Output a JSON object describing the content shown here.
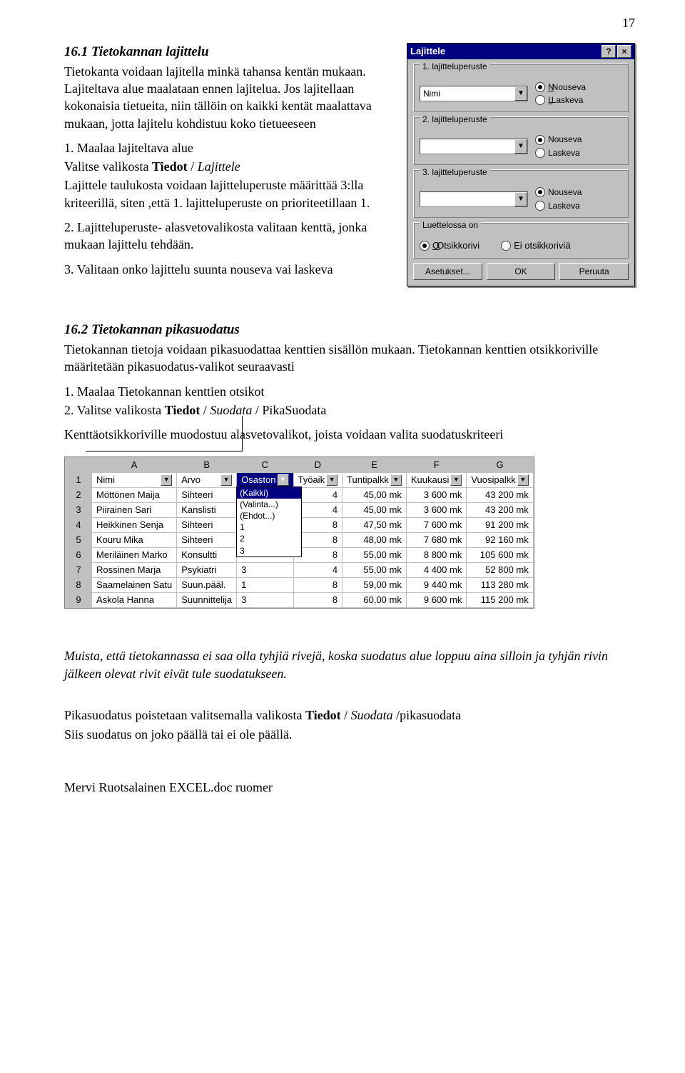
{
  "page_number": "17",
  "section_db_sort_title": "16.1 Tietokannan lajittelu",
  "db_sort_p1": "Tietokanta voidaan lajitella minkä tahansa kentän mukaan. Lajiteltava alue maalataan ennen lajitelua. Jos lajitellaan kokonaisia tietueita, niin tällöin on kaikki kentät maalattava mukaan, jotta lajitelu kohdistuu koko tietueeseen",
  "db_sort_step1_a": "1. Maalaa lajiteltava alue",
  "db_sort_step1_b_prefix": "Valitse valikosta ",
  "db_sort_step1_b_strong": "Tiedot",
  "db_sort_step1_b_mid": " / ",
  "db_sort_step1_b_em": "Lajittele",
  "db_sort_step1_c": "Lajittele taulukosta voidaan lajitteluperuste määrittää 3:lla kriteerillä, siten ,että 1. lajitteluperuste on prioriteetillaan 1.",
  "db_sort_step2": "2. Lajitteluperuste- alasvetovalikosta valitaan kenttä, jonka mukaan lajittelu tehdään.",
  "db_sort_step3": "3. Valitaan onko lajittelu suunta nouseva vai laskeva",
  "dlg": {
    "title": "Lajittele",
    "help_btn": "?",
    "close_btn": "×",
    "g1": "1. lajitteluperuste",
    "g2": "2. lajitteluperuste",
    "g3": "3. lajitteluperuste",
    "combo1": "Nimi",
    "combo2": "",
    "combo3": "",
    "nouseva": "Nouseva",
    "laskeva": "Laskeva",
    "list_legend": "Luettelossa on",
    "opt_header": "Otsikkorivi",
    "opt_noheader": "Ei otsikkoriviä",
    "btn_settings": "Asetukset...",
    "btn_ok": "OK",
    "btn_cancel": "Peruuta"
  },
  "section_quick_title": "16.2 Tietokannan pikasuodatus",
  "quick_p1": "Tietokannan tietoja voidaan pikasuodattaa kenttien sisällön mukaan. Tietokannan kenttien otsikkoriville määritetään pikasuodatus-valikot seuraavasti",
  "quick_step1": "1. Maalaa Tietokannan kenttien otsikot",
  "quick_step2_prefix": "2. Valitse valikosta ",
  "quick_step2_strong": "Tiedot",
  "quick_step2_mid1": " / ",
  "quick_step2_em1": "Suodata",
  "quick_step2_mid2": " / ",
  "quick_step2_tail": "PikaSuodata",
  "quick_p3": "Kenttäotsikkoriville muodostuu alasvetovalikot, joista voidaan valita suodatuskriteeri",
  "sheet": {
    "col_letters": [
      "A",
      "B",
      "C",
      "D",
      "E",
      "F",
      "G"
    ],
    "headers": [
      "Nimi",
      "Arvo",
      "Osaston",
      "Työaik",
      "Tuntipalkk",
      "Kuukausi",
      "Vuosipalkk"
    ],
    "dropdown_items": [
      "(Kaikki)",
      "(Valinta...)",
      "(Ehdot...)",
      "1",
      "2",
      "3"
    ],
    "rows": [
      {
        "n": "2",
        "c": [
          "Möttönen Maija",
          "Sihteeri",
          "",
          "4",
          "45,00 mk",
          "3 600 mk",
          "43 200 mk"
        ]
      },
      {
        "n": "3",
        "c": [
          "Piirainen Sari",
          "Kanslisti",
          "",
          "4",
          "45,00 mk",
          "3 600 mk",
          "43 200 mk"
        ]
      },
      {
        "n": "4",
        "c": [
          "Heikkinen Senja",
          "Sihteeri",
          "",
          "8",
          "47,50 mk",
          "7 600 mk",
          "91 200 mk"
        ]
      },
      {
        "n": "5",
        "c": [
          "Kouru Mika",
          "Sihteeri",
          "",
          "8",
          "48,00 mk",
          "7 680 mk",
          "92 160 mk"
        ]
      },
      {
        "n": "6",
        "c": [
          "Meriläinen Marko",
          "Konsultti",
          "",
          "8",
          "55,00 mk",
          "8 800 mk",
          "105 600 mk"
        ]
      },
      {
        "n": "7",
        "c": [
          "Rossinen Marja",
          "Psykiatri",
          "3",
          "4",
          "55,00 mk",
          "4 400 mk",
          "52 800 mk"
        ]
      },
      {
        "n": "8",
        "c": [
          "Saamelainen Satu",
          "Suun.pääl.",
          "1",
          "8",
          "59,00 mk",
          "9 440 mk",
          "113 280 mk"
        ]
      },
      {
        "n": "9",
        "c": [
          "Askola Hanna",
          "Suunnittelija",
          "3",
          "8",
          "60,00 mk",
          "9 600 mk",
          "115 200 mk"
        ]
      }
    ]
  },
  "note_p1": "Muista, että tietokannassa ei saa olla tyhjiä rivejä, koska suodatus alue loppuu aina silloin ja tyhjän rivin jälkeen olevat rivit eivät tule suodatukseen.",
  "note_p2_prefix": "Pikasuodatus poistetaan valitsemalla valikosta ",
  "note_p2_strong": "Tiedot",
  "note_p2_mid1": " / ",
  "note_p2_em": "Suodata",
  "note_p2_mid2": " /",
  "note_p2_tail": "pikasuodata",
  "note_p3": "Siis suodatus on joko päällä tai ei ole päällä.",
  "footer": "Mervi Ruotsalainen EXCEL.doc   ruomer"
}
